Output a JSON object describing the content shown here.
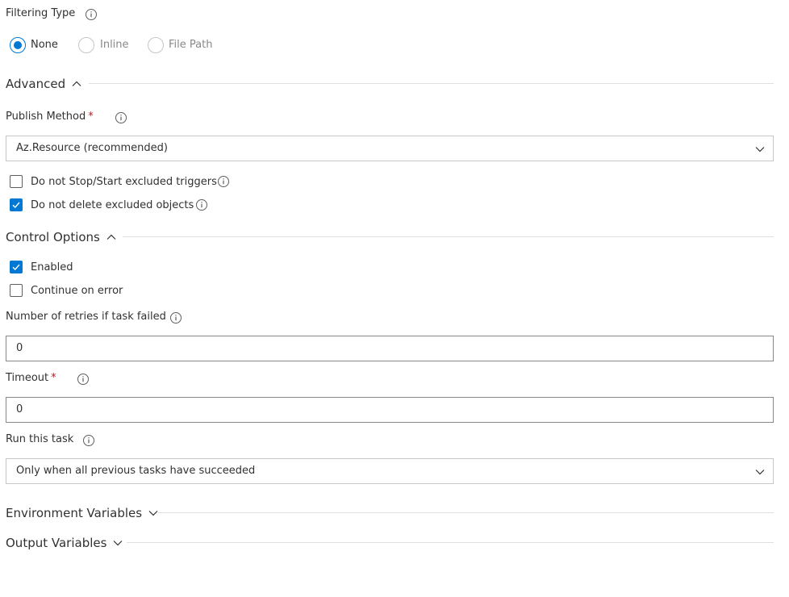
{
  "filtering": {
    "label": "Filtering Type",
    "options": [
      {
        "label": "None",
        "selected": true,
        "disabled": false
      },
      {
        "label": "Inline",
        "selected": false,
        "disabled": true
      },
      {
        "label": "File Path",
        "selected": false,
        "disabled": true
      }
    ]
  },
  "advanced": {
    "title": "Advanced",
    "expanded": true,
    "publish_method": {
      "label": "Publish Method",
      "required_mark": "*",
      "value": "Az.Resource (recommended)"
    },
    "checkboxes": [
      {
        "label": "Do not Stop/Start excluded triggers",
        "checked": false
      },
      {
        "label": "Do not delete excluded objects",
        "checked": true
      }
    ]
  },
  "control_options": {
    "title": "Control Options",
    "expanded": true,
    "checkboxes": [
      {
        "label": "Enabled",
        "checked": true
      },
      {
        "label": "Continue on error",
        "checked": false
      }
    ],
    "retries": {
      "label": "Number of retries if task failed",
      "value": "0"
    },
    "timeout": {
      "label": "Timeout",
      "required_mark": "*",
      "value": "0"
    },
    "run_this_task": {
      "label": "Run this task",
      "value": "Only when all previous tasks have succeeded"
    }
  },
  "environment_variables": {
    "title": "Environment Variables",
    "expanded": false
  },
  "output_variables": {
    "title": "Output Variables",
    "expanded": false
  },
  "colors": {
    "accent": "#0078d4",
    "text": "#323130",
    "disabled_text": "#8a8886",
    "required": "#a4262c",
    "divider": "#e1dfdd",
    "border": "#8a8886"
  },
  "icons": {
    "info": "info-icon",
    "chevron_up": "chevron-up-icon",
    "chevron_down": "chevron-down-icon",
    "checkmark": "checkmark-icon"
  }
}
